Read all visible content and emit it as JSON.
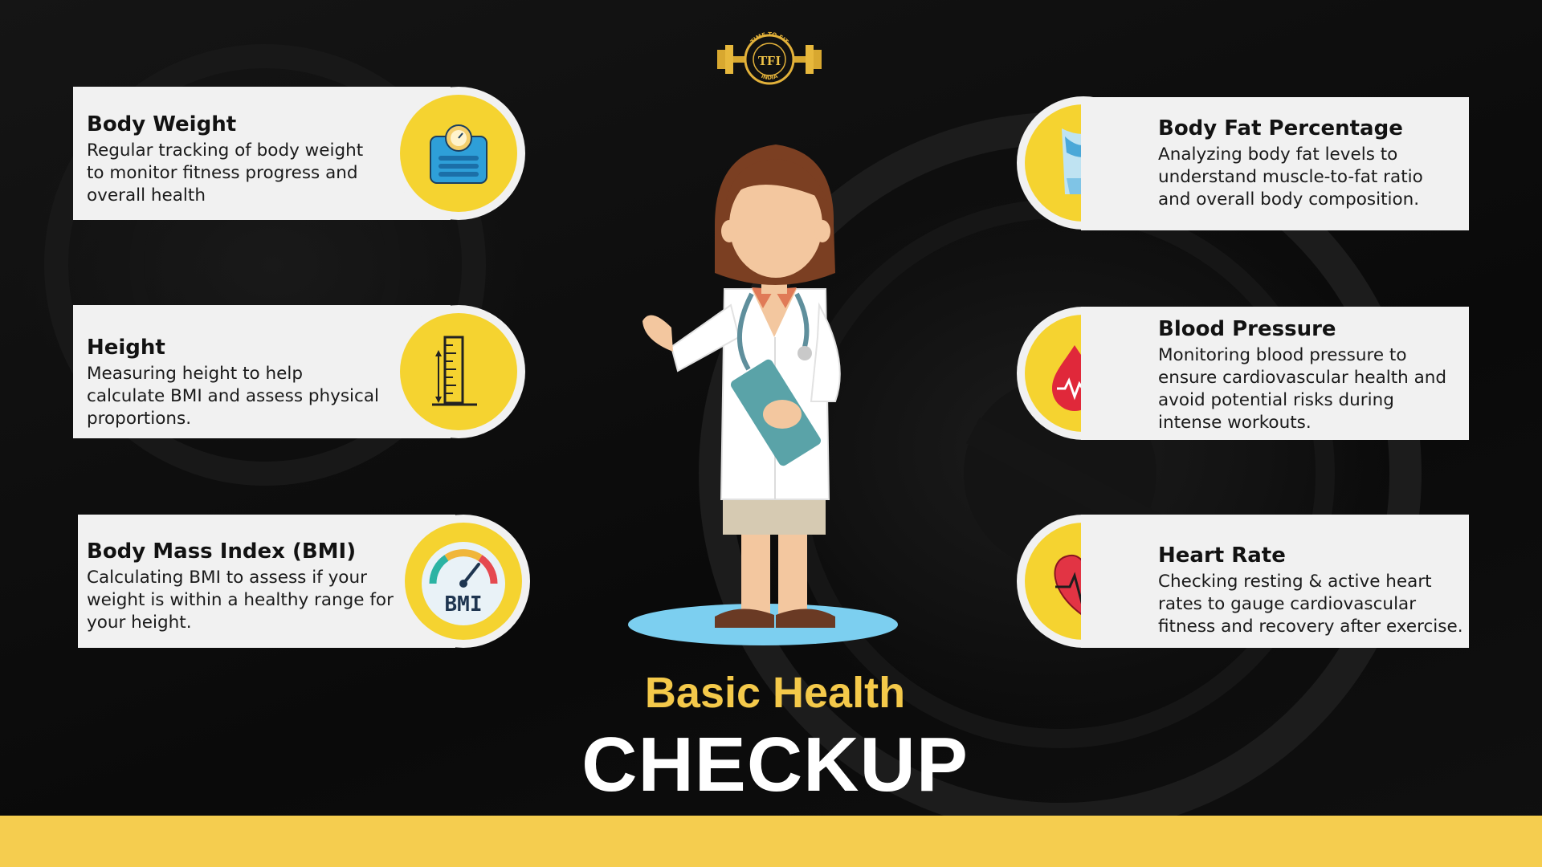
{
  "brand": {
    "logo_ring": "TIME TO FIT",
    "logo_mono": "TFI",
    "logo_bottom": "INDIA"
  },
  "cards": {
    "body_weight": {
      "title": "Body Weight",
      "line1": "Regular tracking of body weight",
      "line2": "to monitor fitness progress and",
      "line3": "overall health",
      "icon": "weighing-scale-icon"
    },
    "height": {
      "title": "Height",
      "line1": "Measuring height to help",
      "line2": "calculate BMI and assess physical",
      "line3": "proportions.",
      "icon": "height-measure-icon"
    },
    "bmi": {
      "title": "Body Mass Index (BMI)",
      "line1": "Calculating BMI to assess if your",
      "line2": "weight is within a healthy range for",
      "line3": "your height.",
      "icon": "bmi-gauge-icon",
      "icon_label": "BMI"
    },
    "body_fat": {
      "title": "Body Fat Percentage",
      "line1": "Analyzing body fat levels to",
      "line2": "understand muscle-to-fat ratio",
      "line3": "and overall body composition.",
      "icon": "body-fat-icon"
    },
    "blood_pressure": {
      "title": "Blood Pressure",
      "line1": "Monitoring blood pressure to",
      "line2": "ensure cardiovascular health and",
      "line3": "avoid potential risks during",
      "line4": "intense workouts.",
      "icon": "blood-pressure-icon"
    },
    "heart_rate": {
      "title": "Heart Rate",
      "line1": "Checking resting & active heart",
      "line2": "rates to gauge cardiovascular",
      "line3": "fitness and recovery after exercise.",
      "icon": "heart-rate-icon"
    }
  },
  "heading": {
    "sub": "Basic Health",
    "main": "CHECKUP"
  },
  "colors": {
    "accent_yellow": "#f5d330",
    "heading_yellow": "#f4c94a",
    "card_bg": "#f1f1f1",
    "footer": "#f5cd4f",
    "background": "#0b0b0b"
  }
}
